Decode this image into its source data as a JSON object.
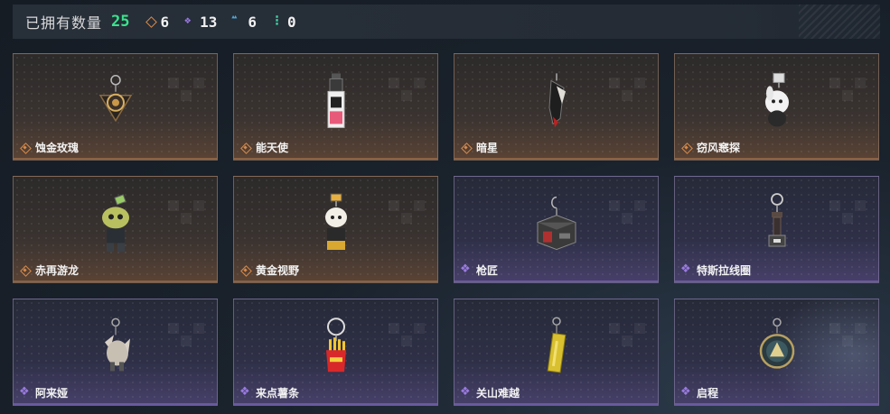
{
  "header": {
    "owned_label": "已拥有数量",
    "owned_count": "25",
    "stats": [
      {
        "icon": "orange-diamond-icon",
        "value": "6",
        "color": "#d98b4a"
      },
      {
        "icon": "purple-clover-icon",
        "value": "13",
        "color": "#9a7be0"
      },
      {
        "icon": "blue-triangle-icon",
        "value": "6",
        "color": "#4aa8d8"
      },
      {
        "icon": "green-dots-icon",
        "value": "0",
        "color": "#40d6a6"
      }
    ]
  },
  "cards": [
    {
      "name": "蚀金玫瑰",
      "rarity": "orange",
      "icon": "rose-charm-icon"
    },
    {
      "name": "能天使",
      "rarity": "orange",
      "icon": "angel-lighter-charm-icon"
    },
    {
      "name": "暗星",
      "rarity": "orange",
      "icon": "dark-star-blade-charm-icon"
    },
    {
      "name": "窃风窸探",
      "rarity": "orange",
      "icon": "white-creature-charm-icon"
    },
    {
      "name": "赤再游龙",
      "rarity": "orange",
      "icon": "dragon-figure-charm-icon"
    },
    {
      "name": "黄金视野",
      "rarity": "orange",
      "icon": "golden-vision-figure-charm-icon"
    },
    {
      "name": "枪匠",
      "rarity": "purple",
      "icon": "gunsmith-box-charm-icon"
    },
    {
      "name": "特斯拉线圈",
      "rarity": "purple",
      "icon": "tesla-coil-charm-icon"
    },
    {
      "name": "阿来娅",
      "rarity": "purple",
      "icon": "alaya-creature-charm-icon"
    },
    {
      "name": "来点薯条",
      "rarity": "purple",
      "icon": "fries-charm-icon"
    },
    {
      "name": "关山难越",
      "rarity": "purple",
      "icon": "gold-bar-charm-icon"
    },
    {
      "name": "启程",
      "rarity": "purple",
      "icon": "emblem-medal-charm-icon"
    }
  ]
}
